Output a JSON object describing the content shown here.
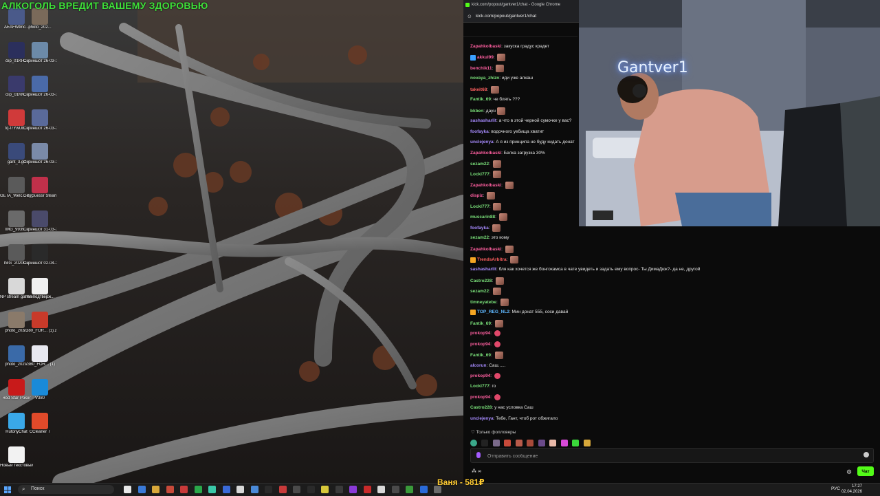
{
  "desktop": {
    "banner": "АЛКОГОЛЬ ВРЕДИТ ВАШЕМУ ЗДОРОВЬЮ",
    "icons": [
      {
        "label": "AEAFWtmc...",
        "color": "#4a5a8a"
      },
      {
        "label": "photo_202...",
        "color": "#7a6a5a"
      },
      {
        "label": "clip_01KH...",
        "color": "#2b2f5c"
      },
      {
        "label": "Скриншот 26-03-20...",
        "color": "#6c8aa8"
      },
      {
        "label": "clip_01KK...",
        "color": "#3a3a6c"
      },
      {
        "label": "Скриншот 26-03-20...",
        "color": "#4a6aa8"
      },
      {
        "label": "fq-f7YwUb...",
        "color": "#d03a3a"
      },
      {
        "label": "Скриншот 26-03-20...",
        "color": "#5a6a9a"
      },
      {
        "label": "gant_3.gif",
        "color": "#3a4a7a"
      },
      {
        "label": "Скриншот 26-03-20...",
        "color": "#7a8aa8"
      },
      {
        "label": "GETA_Welc... 2_gantver...",
        "color": "#5a5a5a"
      },
      {
        "label": "GeoGuessr Steam E...",
        "color": "#c0304a"
      },
      {
        "label": "IMG_9939...",
        "color": "#6a6a6a"
      },
      {
        "label": "Скриншот 31-03-20...",
        "color": "#4a4a6a"
      },
      {
        "label": "IMG_20200...",
        "color": "#5a5a5a"
      },
      {
        "label": "Скриншот 02-04-20...",
        "color": "#2a2a2a"
      },
      {
        "label": "NP stream gantver1...",
        "color": "#d8d8d8"
      },
      {
        "label": "!Не подтверж...",
        "color": "#f0f0f0"
      },
      {
        "label": "photo_202...",
        "color": "#8a7a6a"
      },
      {
        "label": "V380_FOR... (1).zip",
        "color": "#c83a2a"
      },
      {
        "label": "photo_202...",
        "color": "#3a6aa8"
      },
      {
        "label": "V380_FOR... (1)",
        "color": "#e8e8f0"
      },
      {
        "label": "Red Star Poker",
        "color": "#c81a1a"
      },
      {
        "label": "V380",
        "color": "#1a8ad8"
      },
      {
        "label": "RutonyChat",
        "color": "#3aa8e8"
      },
      {
        "label": "CCleaner 7",
        "color": "#e04a2a"
      },
      {
        "label": "Новый текстовый ...",
        "color": "#f2f2f2"
      }
    ]
  },
  "browser": {
    "title": "kick.com/popout/gantver1/chat - Google Chrome",
    "url": "kick.com/popout/gantver1/chat"
  },
  "chat": {
    "messages": [
      {
        "user": "Zapahkolbaski",
        "color": "#ff5fa0",
        "text": "закуска градус крадет",
        "avatar": false,
        "badge": ""
      },
      {
        "user": "akkul99",
        "color": "#ff5fa0",
        "text": "",
        "avatar": true,
        "badge": "#3aa0ff"
      },
      {
        "user": "benchik11",
        "color": "#ff5fa0",
        "text": "",
        "avatar": true,
        "badge": ""
      },
      {
        "user": "novaya_zhizn",
        "color": "#7be27b",
        "text": "иди уже алкаш",
        "avatar": false,
        "badge": ""
      },
      {
        "user": "takeit68",
        "color": "#ff5f5f",
        "text": "",
        "avatar": true,
        "badge": ""
      },
      {
        "user": "Fantik_69",
        "color": "#7be27b",
        "text": "че блять ???",
        "avatar": false,
        "badge": ""
      },
      {
        "user": "bkben",
        "color": "#7be27b",
        "text": "даун",
        "avatar": true,
        "badge": ""
      },
      {
        "user": "sashasharlit",
        "color": "#a78bff",
        "text": "а что в этой черной сумочке у вас?",
        "avatar": false,
        "badge": ""
      },
      {
        "user": "foofayka",
        "color": "#a78bff",
        "text": "водочного уебища хватит",
        "avatar": false,
        "badge": ""
      },
      {
        "user": "unclejenya",
        "color": "#a78bff",
        "text": "А я из принципа не буду кидать донат",
        "avatar": false,
        "badge": ""
      },
      {
        "user": "Zapahkolbaski",
        "color": "#ff5fa0",
        "text": "Белка загрузка 30%",
        "avatar": false,
        "badge": ""
      },
      {
        "user": "sezam22",
        "color": "#7be27b",
        "text": "",
        "avatar": true,
        "badge": ""
      },
      {
        "user": "Lockl777",
        "color": "#7be27b",
        "text": "",
        "avatar": true,
        "badge": ""
      },
      {
        "user": "Zapahkolbaski",
        "color": "#ff5fa0",
        "text": "",
        "avatar": true,
        "badge": ""
      },
      {
        "user": "dispiz",
        "color": "#ff5fa0",
        "text": "",
        "avatar": true,
        "badge": ""
      },
      {
        "user": "Lockl777",
        "color": "#7be27b",
        "text": "",
        "avatar": true,
        "badge": ""
      },
      {
        "user": "muscarin88",
        "color": "#7be27b",
        "text": "",
        "avatar": true,
        "badge": ""
      },
      {
        "user": "foofayka",
        "color": "#a78bff",
        "text": "",
        "avatar": true,
        "badge": ""
      },
      {
        "user": "sezam22",
        "color": "#7be27b",
        "text": "это кому",
        "avatar": false,
        "badge": ""
      },
      {
        "user": "Zapahkolbaski",
        "color": "#ff5fa0",
        "text": "",
        "avatar": true,
        "badge": ""
      },
      {
        "user": "TrendsArbitra",
        "color": "#ff5f5f",
        "text": "",
        "avatar": true,
        "badge": "#f5a623"
      },
      {
        "user": "sashasharlit",
        "color": "#a78bff",
        "text": "бля как хочется же бонгокамса в чате увидеть и задать ему вопрос- Ты ДимаДюк?- да не, другой",
        "avatar": false,
        "badge": ""
      },
      {
        "user": "Castro228",
        "color": "#7be27b",
        "text": "",
        "avatar": true,
        "badge": ""
      },
      {
        "user": "sezam22",
        "color": "#7be27b",
        "text": "",
        "avatar": true,
        "badge": ""
      },
      {
        "user": "timneyatebe",
        "color": "#7be27b",
        "text": "",
        "avatar": true,
        "badge": ""
      },
      {
        "user": "TOP_REG_NL2",
        "color": "#5fb8ff",
        "text": "Мин донат 555, соси давай",
        "avatar": false,
        "badge": "#f5a623"
      },
      {
        "user": "Fantik_69",
        "color": "#7be27b",
        "text": "",
        "avatar": true,
        "badge": ""
      },
      {
        "user": "prokop94",
        "color": "#ff5fa0",
        "text": "",
        "avatar": "small",
        "badge": ""
      },
      {
        "user": "prokop94",
        "color": "#ff5fa0",
        "text": "",
        "avatar": "small",
        "badge": ""
      },
      {
        "user": "Fantik_69",
        "color": "#7be27b",
        "text": "",
        "avatar": true,
        "badge": ""
      },
      {
        "user": "alcorun",
        "color": "#a78bff",
        "text": "Саш......",
        "avatar": false,
        "badge": ""
      },
      {
        "user": "prokop94",
        "color": "#ff5fa0",
        "text": "",
        "avatar": "small",
        "badge": ""
      },
      {
        "user": "Lockl777",
        "color": "#7be27b",
        "text": "го",
        "avatar": false,
        "badge": ""
      },
      {
        "user": "prokop94",
        "color": "#ff5fa0",
        "text": "",
        "avatar": "small",
        "badge": ""
      },
      {
        "user": "Castro228",
        "color": "#7be27b",
        "text": "у нас условка Саш",
        "avatar": false,
        "badge": ""
      },
      {
        "user": "unclejenya",
        "color": "#a78bff",
        "text": "Тебе, Гант, чтоб рот обжигало",
        "avatar": false,
        "badge": ""
      }
    ],
    "followers_label": "Только фолловеры",
    "input_placeholder": "Отправить сообщение",
    "points": "∞",
    "send_label": "Чат"
  },
  "webcam": {
    "streamer_name": "Gantver1"
  },
  "donation_overlay": "Ваня - 581₽",
  "taskbar": {
    "search_placeholder": "Поиск",
    "lang": "РУС",
    "time": "17:27",
    "date": "02.04.2026"
  }
}
